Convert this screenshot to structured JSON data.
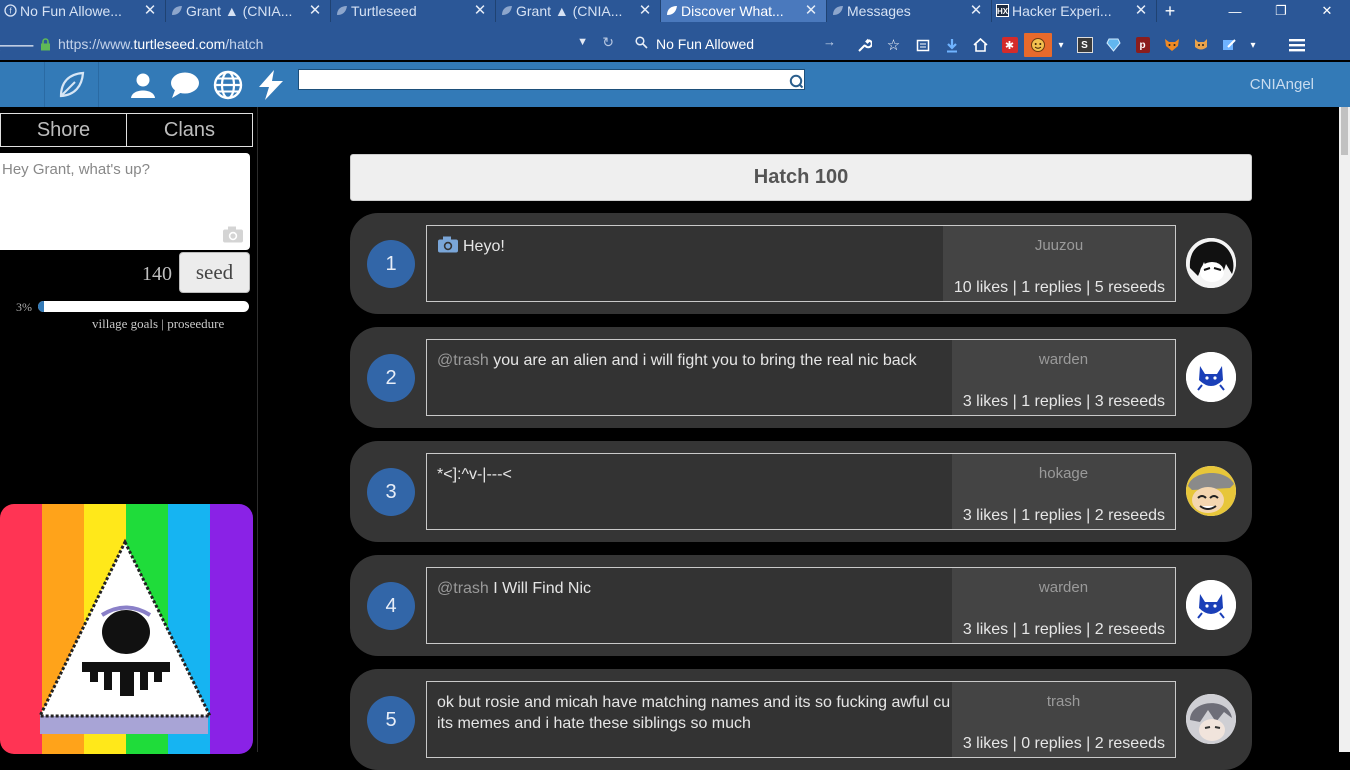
{
  "browser": {
    "tabs": [
      {
        "title": "No Fun Allowe...",
        "favicon": "globe-icon",
        "active": false
      },
      {
        "title": "Grant ▲ (CNIA...",
        "favicon": "leaf-icon",
        "active": false
      },
      {
        "title": "Turtleseed",
        "favicon": "leaf-icon",
        "active": false
      },
      {
        "title": "Grant ▲ (CNIA...",
        "favicon": "leaf-icon",
        "active": false
      },
      {
        "title": "Discover What...",
        "favicon": "leaf-icon",
        "active": true
      },
      {
        "title": "Messages",
        "favicon": "leaf-icon",
        "active": false
      },
      {
        "title": "Hacker Experi...",
        "favicon": "hx-icon",
        "active": false
      }
    ],
    "url": {
      "prefix": "https://www.",
      "domain": "turtleseed.com",
      "path": "/hatch"
    },
    "search_text": "No Fun Allowed",
    "accent_color": "#2b5797"
  },
  "site": {
    "header_color": "#337ab7",
    "username": "CNIAngel",
    "search_placeholder": ""
  },
  "sidebar": {
    "tabs": [
      "Shore",
      "Clans"
    ],
    "composer_placeholder": "Hey Grant, what's up?",
    "char_count": "140",
    "seed_label": "seed",
    "progress_label": "3%",
    "progress_fraction": 0.03,
    "links": {
      "goals": "village goals",
      "separator": " | ",
      "procedure": "proseedure"
    }
  },
  "feed": {
    "title": "Hatch 100",
    "posts": [
      {
        "rank": "1",
        "has_camera": true,
        "mention": "",
        "text": "Heyo!",
        "author": "Juuzou",
        "stats": "10 likes | 1 replies | 5 reseeds",
        "avatar": "anime-avatar-juuzou"
      },
      {
        "rank": "2",
        "has_camera": false,
        "mention": "@trash",
        "text": " you are an alien and i will fight you to bring the real nic back",
        "author": "warden",
        "stats": "3 likes | 1 replies | 3 reseeds",
        "avatar": "blue-cat-avatar"
      },
      {
        "rank": "3",
        "has_camera": false,
        "mention": "",
        "text": "*<]:^v-|---<",
        "author": "hokage",
        "stats": "3 likes | 1 replies | 2 reseeds",
        "avatar": "anime-avatar-hokage"
      },
      {
        "rank": "4",
        "has_camera": false,
        "mention": "@trash",
        "text": " I Will Find Nic",
        "author": "warden",
        "stats": "3 likes | 1 replies | 2 reseeds",
        "avatar": "blue-cat-avatar"
      },
      {
        "rank": "5",
        "has_camera": false,
        "mention": "",
        "text": "ok but rosie and micah have matching names and its so fucking awful cu its memes and i hate these siblings so much",
        "author": "trash",
        "stats": "3 likes | 0 replies | 2 reseeds",
        "avatar": "anime-avatar-trash"
      }
    ]
  }
}
